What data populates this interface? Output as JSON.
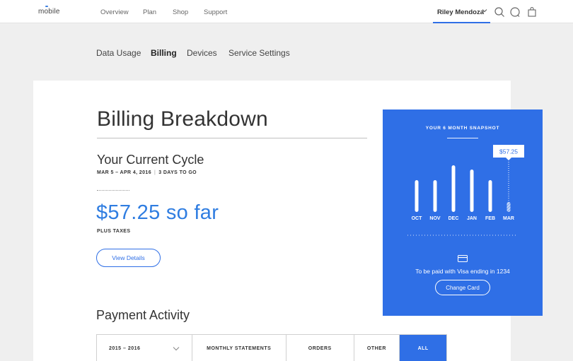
{
  "header": {
    "logo": "mobile",
    "nav": [
      "Overview",
      "Plan",
      "Shop",
      "Support"
    ],
    "user_name": "Riley Mendoza",
    "icons": [
      "chevron-down-icon",
      "search-icon",
      "chat-icon",
      "bag-icon"
    ]
  },
  "subnav": {
    "items": [
      "Data Usage",
      "Billing",
      "Devices",
      "Service Settings"
    ],
    "active": "Billing"
  },
  "billing": {
    "title": "Billing Breakdown",
    "cycle_title": "Your Current Cycle",
    "cycle_dates": "MAR 5 – APR 4, 2016",
    "cycle_remaining": "3 DAYS TO GO",
    "amount": "$57.25 so far",
    "taxes_note": "PLUS TAXES",
    "view_details_label": "View Details"
  },
  "payment_activity": {
    "title": "Payment Activity",
    "filters": [
      "2015 – 2016",
      "MONTHLY STATEMENTS",
      "ORDERS",
      "OTHER",
      "ALL"
    ],
    "active_filter": "ALL"
  },
  "snapshot": {
    "title": "YOUR 6 MONTH SNAPSHOT",
    "tooltip": "$57.25",
    "payment_text": "To be paid with Visa ending in 1234",
    "change_card_label": "Change Card"
  },
  "colors": {
    "accent": "#2f6fe6",
    "amount_text": "#2f7de1",
    "panel_bg": "#2f6fe6",
    "page_bg": "#efefef"
  },
  "chart_data": {
    "type": "bar",
    "categories": [
      "OCT",
      "NOV",
      "DEC",
      "JAN",
      "FEB",
      "MAR"
    ],
    "values": [
      0.6,
      0.6,
      0.88,
      0.8,
      0.6,
      0.19
    ],
    "value_unit": "fraction of chart height (no y-axis printed)",
    "highlight_index": 5,
    "highlight_style": "hatched (in progress)",
    "tooltip_on": "MAR"
  }
}
